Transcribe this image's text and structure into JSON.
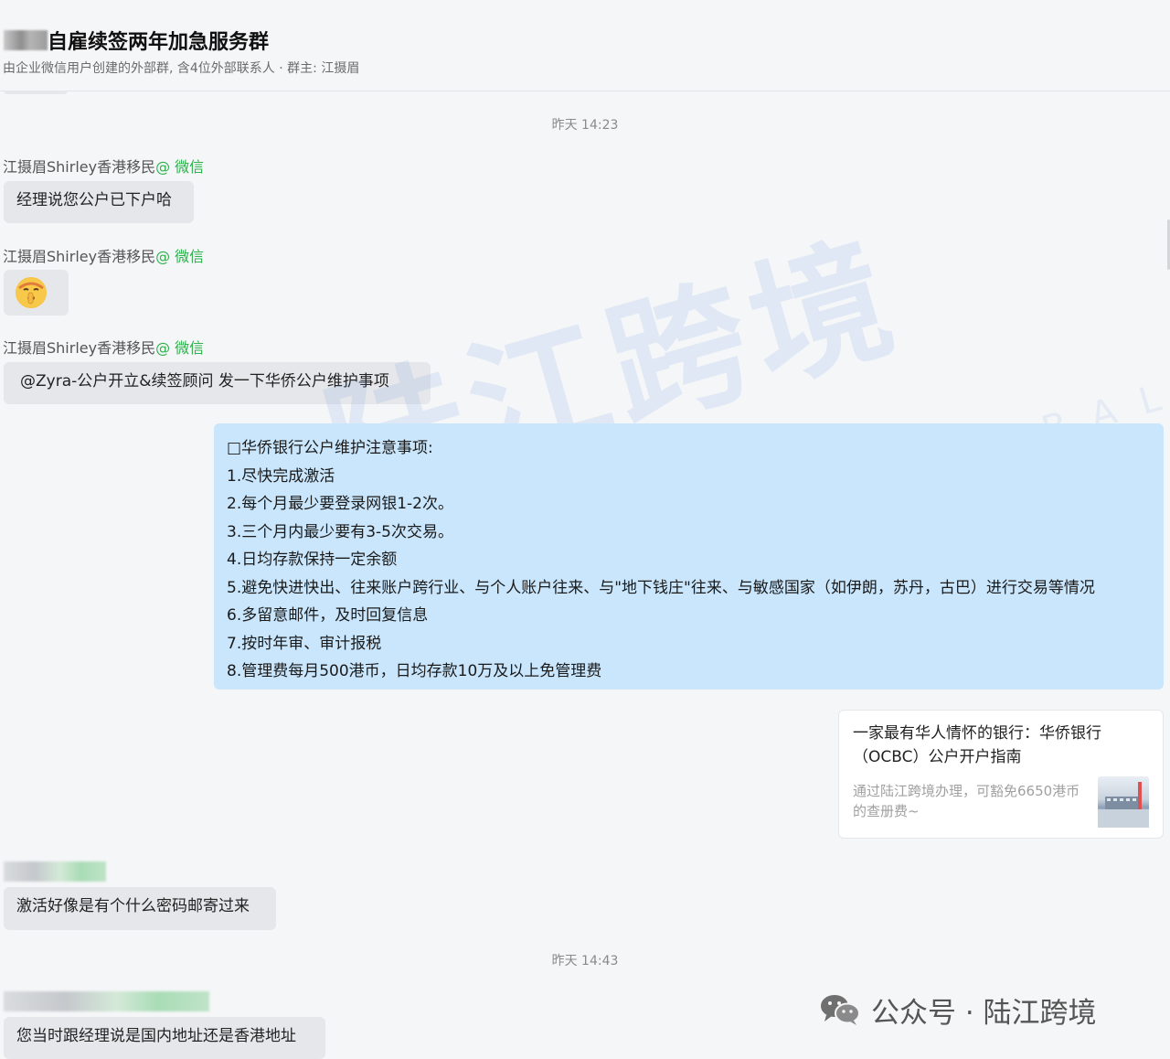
{
  "header": {
    "title": "自雇续签两年加急服务群",
    "subtitle": "由企业微信用户创建的外部群, 含4位外部联系人 · 群主: 江摄眉"
  },
  "timestamps": [
    "昨天 14:23",
    "昨天 14:43"
  ],
  "messages": {
    "m1": {
      "sender": "江摄眉Shirley香港移民",
      "tag": "@ 微信",
      "text": "经理说您公户已下户哈"
    },
    "m2": {
      "sender": "江摄眉Shirley香港移民",
      "tag": "@ 微信",
      "emoji_icon": "shushing-face-emoji"
    },
    "m3": {
      "sender": "江摄眉Shirley香港移民",
      "tag": "@ 微信",
      "text": "@Zyra-公户开立&续签顾问  发一下华侨公户维护事项"
    },
    "sent_notice": {
      "lines": [
        "□华侨银行公户维护注意事项:",
        "1.尽快完成激活",
        "2.每个月最少要登录网银1-2次。",
        "3.三个月内最少要有3-5次交易。",
        "4.日均存款保持一定余额",
        "5.避免快进快出、往来账户跨行业、与个人账户往来、与\"地下钱庄\"往来、与敏感国家（如伊朗，苏丹，古巴）进行交易等情况",
        "6.多留意邮件，及时回复信息",
        "7.按时年审、审计报税",
        "8.管理费每月500港币，日均存款10万及以上免管理费"
      ]
    },
    "link_card": {
      "title": "一家最有华人情怀的银行：华侨银行（OCBC）公户开户指南",
      "desc": "通过陆江跨境办理，可豁免6650港币的查册费~"
    },
    "m4": {
      "text": "激活好像是有个什么密码邮寄过来"
    },
    "m5": {
      "text": "您当时跟经理说是国内地址还是香港地址"
    }
  },
  "watermark": {
    "main": "陆江跨境",
    "sub": "LANDRIVER GLOBAL"
  },
  "brand": {
    "text": "公众号 · 陆江跨境",
    "icon": "wechat-icon"
  },
  "colors": {
    "accent_green": "#2db14c",
    "sent_bubble": "#c9e6fc",
    "received_bubble": "#e6e7ea"
  }
}
